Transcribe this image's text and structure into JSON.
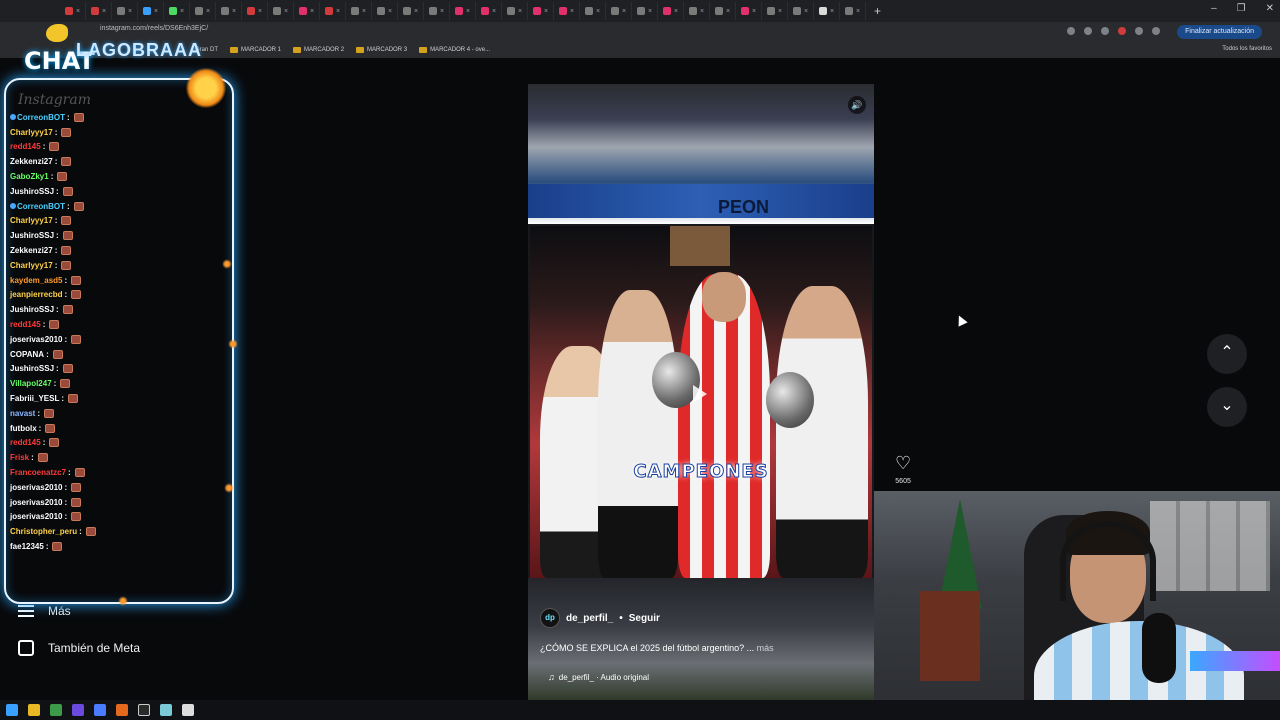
{
  "browser": {
    "url": "instagram.com/reels/DS6Enh3EjC/",
    "update_button": "Finalizar actualización",
    "tab_colors": [
      "#d23b3b",
      "#d23b3b",
      "#7a7a7a",
      "#3aa0ff",
      "#4cd964",
      "#7a7a7a",
      "#7a7a7a",
      "#d23b3b",
      "#7a7a7a",
      "#e1306c",
      "#d23b3b",
      "#7a7a7a",
      "#7a7a7a",
      "#7a7a7a",
      "#7a7a7a",
      "#e1306c",
      "#e1306c",
      "#7a7a7a",
      "#e1306c",
      "#e1306c",
      "#7a7a7a",
      "#7a7a7a",
      "#7a7a7a",
      "#e1306c",
      "#7a7a7a",
      "#7a7a7a",
      "#e1306c",
      "#7a7a7a",
      "#7a7a7a",
      "#dadada",
      "#7a7a7a"
    ],
    "new_tab": "+",
    "window_controls": [
      "–",
      "❐",
      "✕"
    ],
    "bookmarks": [
      {
        "label": "Gran DT",
        "folder": false
      },
      {
        "label": "MARCADOR 1",
        "folder": true
      },
      {
        "label": "MARCADOR 2",
        "folder": true
      },
      {
        "label": "MARCADOR 3",
        "folder": true
      },
      {
        "label": "MARCADOR 4 - ove...",
        "folder": true
      }
    ],
    "all_bookmarks": "Todos los favoritos"
  },
  "overlay": {
    "chat_title": "CHAT",
    "brand": "LAGOBRAAA",
    "instagram_faint": "Instagram"
  },
  "chat": [
    {
      "user": "CorreonBOT",
      "color": "#4ad0ff",
      "badge": true
    },
    {
      "user": "Charlyyy17",
      "color": "#ffd24a"
    },
    {
      "user": "redd145",
      "color": "#ff3a3a"
    },
    {
      "user": "Zekkenzi27",
      "color": "#ffffff"
    },
    {
      "user": "GaboZky1",
      "color": "#66ff66"
    },
    {
      "user": "JushiroSSJ",
      "color": "#ffffff"
    },
    {
      "user": "CorreonBOT",
      "color": "#4ad0ff",
      "badge": true
    },
    {
      "user": "Charlyyy17",
      "color": "#ffd24a"
    },
    {
      "user": "JushiroSSJ",
      "color": "#ffffff"
    },
    {
      "user": "Zekkenzi27",
      "color": "#ffffff"
    },
    {
      "user": "Charlyyy17",
      "color": "#ffd24a"
    },
    {
      "user": "kaydem_asd5",
      "color": "#ff9a2e"
    },
    {
      "user": "jeanpierrecbd",
      "color": "#ffd24a"
    },
    {
      "user": "JushiroSSJ",
      "color": "#ffffff"
    },
    {
      "user": "redd145",
      "color": "#ff3a3a"
    },
    {
      "user": "joserivas2010",
      "color": "#ffffff"
    },
    {
      "user": "COPANA",
      "color": "#ffffff"
    },
    {
      "user": "JushiroSSJ",
      "color": "#ffffff"
    },
    {
      "user": "Villapol247",
      "color": "#66ff66"
    },
    {
      "user": "Fabriii_YESL",
      "color": "#ffffff"
    },
    {
      "user": "navast",
      "color": "#8ab8ff"
    },
    {
      "user": "futbolx",
      "color": "#ffffff"
    },
    {
      "user": "redd145",
      "color": "#ff3a3a"
    },
    {
      "user": "Frisk",
      "color": "#ff3a3a"
    },
    {
      "user": "Francoenatzc7",
      "color": "#ff3a3a"
    },
    {
      "user": "joserivas2010",
      "color": "#ffffff"
    },
    {
      "user": "joserivas2010",
      "color": "#ffffff"
    },
    {
      "user": "joserivas2010",
      "color": "#ffffff"
    },
    {
      "user": "Christopher_peru",
      "color": "#ffd24a"
    },
    {
      "user": "fae12345",
      "color": "#ffffff"
    }
  ],
  "chat_separator": ":",
  "ig_nav": {
    "more": "Más",
    "meta": "También de Meta"
  },
  "reel": {
    "banner_text": "PEON",
    "overlay_text": "CAMPEONES",
    "author": "de_perfil_",
    "avatar_text": "dp",
    "follow": "Seguir",
    "caption": "¿CÓMO SE EXPLICA el 2025 del fútbol argentino? ...",
    "caption_more": "más",
    "audio": "de_perfil_ · Audio original",
    "likes": "5605"
  },
  "icons": {
    "volume": "🔊",
    "heart": "♡",
    "up": "⌃",
    "down": "⌄",
    "music": "♫"
  }
}
